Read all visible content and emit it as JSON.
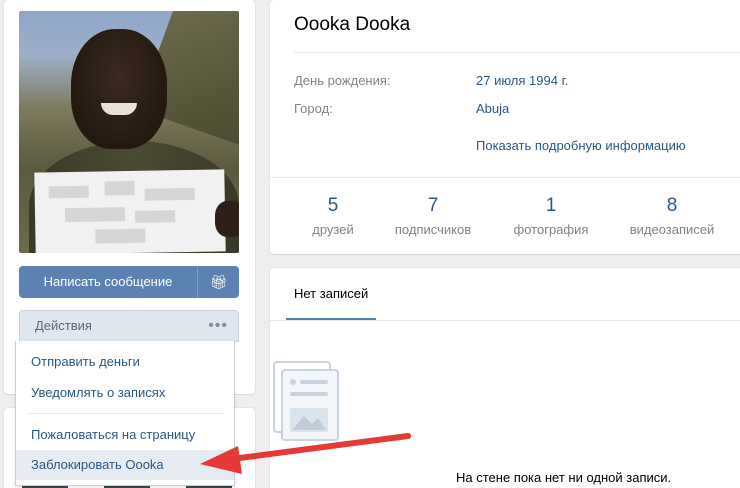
{
  "profile": {
    "name": "Oooka Dooka",
    "info": [
      {
        "label": "День рождения:",
        "value": "27 июля 1994 г."
      },
      {
        "label": "Город:",
        "value": "Abuja"
      }
    ],
    "more_info_link": "Показать подробную информацию",
    "counters": [
      {
        "num": "5",
        "cap": "друзей"
      },
      {
        "num": "7",
        "cap": "подписчиков"
      },
      {
        "num": "1",
        "cap": "фотография"
      },
      {
        "num": "8",
        "cap": "видеозаписей"
      }
    ]
  },
  "buttons": {
    "message": "Написать сообщение",
    "gift_icon": "gift-icon"
  },
  "actions": {
    "header": "Действия",
    "dots": "•••",
    "items": [
      "Отправить деньги",
      "Уведомлять о записях",
      "Пожаловаться на страницу",
      "Заблокировать Oooka"
    ]
  },
  "wall": {
    "tab": "Нет записей",
    "empty_text": "На стене пока нет ни одной записи."
  },
  "colors": {
    "accent": "#5181b8",
    "link": "#2a5885",
    "arrow": "#e53935"
  }
}
